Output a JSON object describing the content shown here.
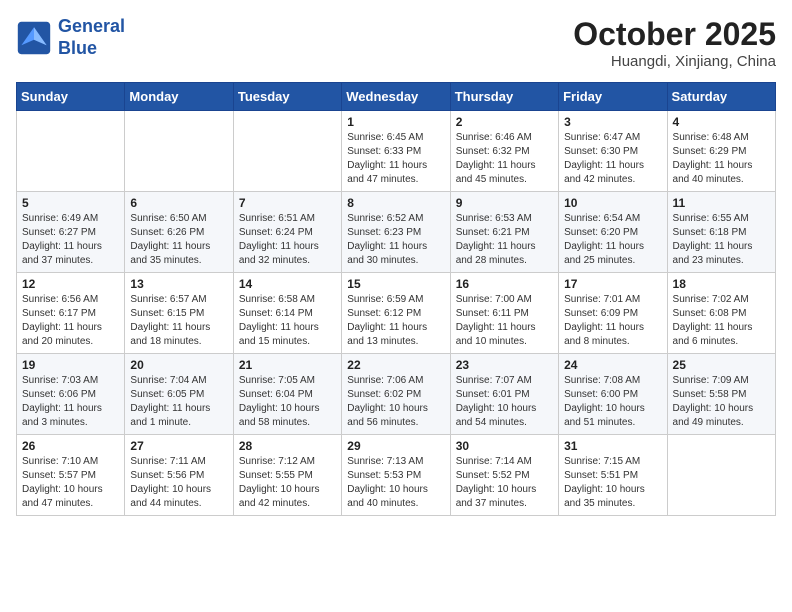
{
  "header": {
    "logo_line1": "General",
    "logo_line2": "Blue",
    "month_title": "October 2025",
    "location": "Huangdi, Xinjiang, China"
  },
  "weekdays": [
    "Sunday",
    "Monday",
    "Tuesday",
    "Wednesday",
    "Thursday",
    "Friday",
    "Saturday"
  ],
  "weeks": [
    [
      {
        "day": "",
        "sunrise": "",
        "sunset": "",
        "daylight": ""
      },
      {
        "day": "",
        "sunrise": "",
        "sunset": "",
        "daylight": ""
      },
      {
        "day": "",
        "sunrise": "",
        "sunset": "",
        "daylight": ""
      },
      {
        "day": "1",
        "sunrise": "Sunrise: 6:45 AM",
        "sunset": "Sunset: 6:33 PM",
        "daylight": "Daylight: 11 hours and 47 minutes."
      },
      {
        "day": "2",
        "sunrise": "Sunrise: 6:46 AM",
        "sunset": "Sunset: 6:32 PM",
        "daylight": "Daylight: 11 hours and 45 minutes."
      },
      {
        "day": "3",
        "sunrise": "Sunrise: 6:47 AM",
        "sunset": "Sunset: 6:30 PM",
        "daylight": "Daylight: 11 hours and 42 minutes."
      },
      {
        "day": "4",
        "sunrise": "Sunrise: 6:48 AM",
        "sunset": "Sunset: 6:29 PM",
        "daylight": "Daylight: 11 hours and 40 minutes."
      }
    ],
    [
      {
        "day": "5",
        "sunrise": "Sunrise: 6:49 AM",
        "sunset": "Sunset: 6:27 PM",
        "daylight": "Daylight: 11 hours and 37 minutes."
      },
      {
        "day": "6",
        "sunrise": "Sunrise: 6:50 AM",
        "sunset": "Sunset: 6:26 PM",
        "daylight": "Daylight: 11 hours and 35 minutes."
      },
      {
        "day": "7",
        "sunrise": "Sunrise: 6:51 AM",
        "sunset": "Sunset: 6:24 PM",
        "daylight": "Daylight: 11 hours and 32 minutes."
      },
      {
        "day": "8",
        "sunrise": "Sunrise: 6:52 AM",
        "sunset": "Sunset: 6:23 PM",
        "daylight": "Daylight: 11 hours and 30 minutes."
      },
      {
        "day": "9",
        "sunrise": "Sunrise: 6:53 AM",
        "sunset": "Sunset: 6:21 PM",
        "daylight": "Daylight: 11 hours and 28 minutes."
      },
      {
        "day": "10",
        "sunrise": "Sunrise: 6:54 AM",
        "sunset": "Sunset: 6:20 PM",
        "daylight": "Daylight: 11 hours and 25 minutes."
      },
      {
        "day": "11",
        "sunrise": "Sunrise: 6:55 AM",
        "sunset": "Sunset: 6:18 PM",
        "daylight": "Daylight: 11 hours and 23 minutes."
      }
    ],
    [
      {
        "day": "12",
        "sunrise": "Sunrise: 6:56 AM",
        "sunset": "Sunset: 6:17 PM",
        "daylight": "Daylight: 11 hours and 20 minutes."
      },
      {
        "day": "13",
        "sunrise": "Sunrise: 6:57 AM",
        "sunset": "Sunset: 6:15 PM",
        "daylight": "Daylight: 11 hours and 18 minutes."
      },
      {
        "day": "14",
        "sunrise": "Sunrise: 6:58 AM",
        "sunset": "Sunset: 6:14 PM",
        "daylight": "Daylight: 11 hours and 15 minutes."
      },
      {
        "day": "15",
        "sunrise": "Sunrise: 6:59 AM",
        "sunset": "Sunset: 6:12 PM",
        "daylight": "Daylight: 11 hours and 13 minutes."
      },
      {
        "day": "16",
        "sunrise": "Sunrise: 7:00 AM",
        "sunset": "Sunset: 6:11 PM",
        "daylight": "Daylight: 11 hours and 10 minutes."
      },
      {
        "day": "17",
        "sunrise": "Sunrise: 7:01 AM",
        "sunset": "Sunset: 6:09 PM",
        "daylight": "Daylight: 11 hours and 8 minutes."
      },
      {
        "day": "18",
        "sunrise": "Sunrise: 7:02 AM",
        "sunset": "Sunset: 6:08 PM",
        "daylight": "Daylight: 11 hours and 6 minutes."
      }
    ],
    [
      {
        "day": "19",
        "sunrise": "Sunrise: 7:03 AM",
        "sunset": "Sunset: 6:06 PM",
        "daylight": "Daylight: 11 hours and 3 minutes."
      },
      {
        "day": "20",
        "sunrise": "Sunrise: 7:04 AM",
        "sunset": "Sunset: 6:05 PM",
        "daylight": "Daylight: 11 hours and 1 minute."
      },
      {
        "day": "21",
        "sunrise": "Sunrise: 7:05 AM",
        "sunset": "Sunset: 6:04 PM",
        "daylight": "Daylight: 10 hours and 58 minutes."
      },
      {
        "day": "22",
        "sunrise": "Sunrise: 7:06 AM",
        "sunset": "Sunset: 6:02 PM",
        "daylight": "Daylight: 10 hours and 56 minutes."
      },
      {
        "day": "23",
        "sunrise": "Sunrise: 7:07 AM",
        "sunset": "Sunset: 6:01 PM",
        "daylight": "Daylight: 10 hours and 54 minutes."
      },
      {
        "day": "24",
        "sunrise": "Sunrise: 7:08 AM",
        "sunset": "Sunset: 6:00 PM",
        "daylight": "Daylight: 10 hours and 51 minutes."
      },
      {
        "day": "25",
        "sunrise": "Sunrise: 7:09 AM",
        "sunset": "Sunset: 5:58 PM",
        "daylight": "Daylight: 10 hours and 49 minutes."
      }
    ],
    [
      {
        "day": "26",
        "sunrise": "Sunrise: 7:10 AM",
        "sunset": "Sunset: 5:57 PM",
        "daylight": "Daylight: 10 hours and 47 minutes."
      },
      {
        "day": "27",
        "sunrise": "Sunrise: 7:11 AM",
        "sunset": "Sunset: 5:56 PM",
        "daylight": "Daylight: 10 hours and 44 minutes."
      },
      {
        "day": "28",
        "sunrise": "Sunrise: 7:12 AM",
        "sunset": "Sunset: 5:55 PM",
        "daylight": "Daylight: 10 hours and 42 minutes."
      },
      {
        "day": "29",
        "sunrise": "Sunrise: 7:13 AM",
        "sunset": "Sunset: 5:53 PM",
        "daylight": "Daylight: 10 hours and 40 minutes."
      },
      {
        "day": "30",
        "sunrise": "Sunrise: 7:14 AM",
        "sunset": "Sunset: 5:52 PM",
        "daylight": "Daylight: 10 hours and 37 minutes."
      },
      {
        "day": "31",
        "sunrise": "Sunrise: 7:15 AM",
        "sunset": "Sunset: 5:51 PM",
        "daylight": "Daylight: 10 hours and 35 minutes."
      },
      {
        "day": "",
        "sunrise": "",
        "sunset": "",
        "daylight": ""
      }
    ]
  ]
}
